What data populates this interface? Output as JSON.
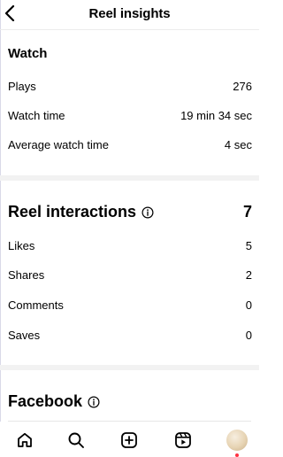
{
  "header": {
    "title": "Reel insights"
  },
  "watch": {
    "title": "Watch",
    "rows": [
      {
        "label": "Plays",
        "value": "276"
      },
      {
        "label": "Watch time",
        "value": "19 min 34 sec"
      },
      {
        "label": "Average watch time",
        "value": "4 sec"
      }
    ]
  },
  "interactions": {
    "title": "Reel interactions",
    "total": "7",
    "rows": [
      {
        "label": "Likes",
        "value": "5"
      },
      {
        "label": "Shares",
        "value": "2"
      },
      {
        "label": "Comments",
        "value": "0"
      },
      {
        "label": "Saves",
        "value": "0"
      }
    ]
  },
  "facebook": {
    "title": "Facebook"
  },
  "tabbar": {
    "items": [
      "home-icon",
      "search-icon",
      "create-icon",
      "reels-icon",
      "profile-avatar"
    ],
    "notification_color": "#ff3040"
  }
}
